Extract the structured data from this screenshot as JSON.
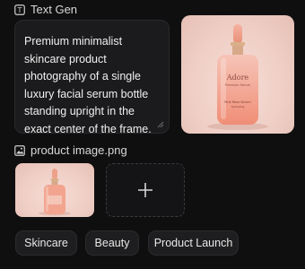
{
  "textgen": {
    "header_label": "Text Gen",
    "prompt_text": "Premium minimalist skincare product photography of a single luxury facial serum bottle standing upright in the exact center of the frame."
  },
  "preview": {
    "brand_name": "Adore",
    "brand_sub": "Premium Serum",
    "label_line1": "Pink Rose Serum",
    "label_line2": "Hydrating"
  },
  "image_input": {
    "header_label": "product image.png"
  },
  "tags": [
    "Skincare",
    "Beauty",
    "Product Launch"
  ],
  "colors": {
    "background": "#0f0f10",
    "card": "#1b1b1d",
    "serum_pink": "#f2a48f"
  }
}
